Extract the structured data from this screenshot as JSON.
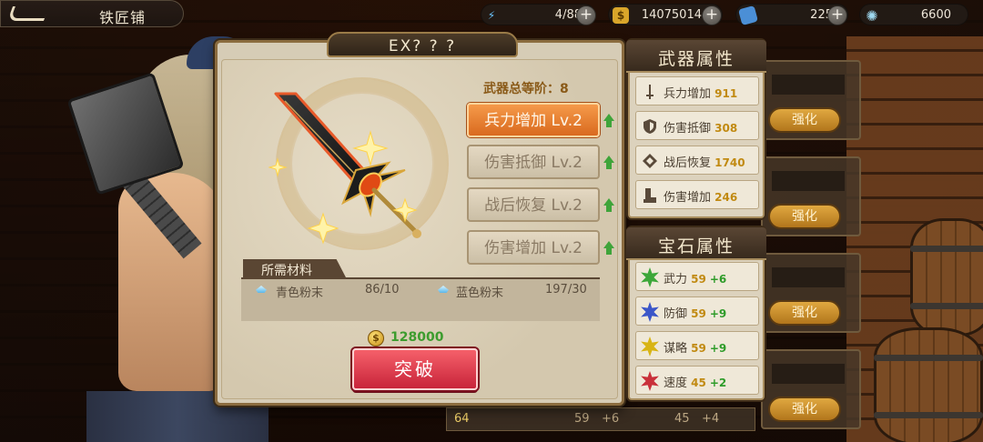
{
  "topbar": {
    "back_title": "铁匠铺",
    "stamina": "4/88",
    "gold": "14075014",
    "items": "225",
    "crystals": "6600",
    "plus": "+"
  },
  "dialog": {
    "title": "EX? ? ?",
    "rank_label": "武器总等阶：8",
    "stats": [
      {
        "label": "兵力增加 Lv.2",
        "state": "active"
      },
      {
        "label": "伤害抵御 Lv.2",
        "state": "inactive"
      },
      {
        "label": "战后恢复 Lv.2",
        "state": "inactive"
      },
      {
        "label": "伤害增加 Lv.2",
        "state": "inactive"
      }
    ],
    "materials_header": "所需材料",
    "materials": [
      {
        "name": "青色粉末",
        "count": "86/10"
      },
      {
        "name": "蓝色粉末",
        "count": "197/30"
      }
    ],
    "gold_cost": "128000",
    "gold_symbol": "$",
    "break_button": "突破"
  },
  "weapon_panel": {
    "title": "武器属性",
    "rows": [
      {
        "label": "兵力增加",
        "value": "911",
        "icon": "sword-icon"
      },
      {
        "label": "伤害抵御",
        "value": "308",
        "icon": "shield-icon"
      },
      {
        "label": "战后恢复",
        "value": "1740",
        "icon": "heal-icon"
      },
      {
        "label": "伤害增加",
        "value": "246",
        "icon": "boot-icon"
      }
    ]
  },
  "gem_panel": {
    "title": "宝石属性",
    "rows": [
      {
        "label": "武力",
        "value": "59",
        "bonus": "+6",
        "color": "#3da73a"
      },
      {
        "label": "防御",
        "value": "59",
        "bonus": "+9",
        "color": "#3b56c8"
      },
      {
        "label": "谋略",
        "value": "59",
        "bonus": "+9",
        "color": "#d8b414"
      },
      {
        "label": "速度",
        "value": "45",
        "bonus": "+2",
        "color": "#c9303a"
      }
    ]
  },
  "background_list": {
    "enhance_label": "强化",
    "bottom_left_value": "59",
    "bottom_left_bonus": "+6",
    "bottom_right_value": "45",
    "bottom_right_bonus": "+4",
    "level_badge": "64"
  },
  "colors": {
    "accent_orange": "#e07a2a",
    "break_red": "#d8303f",
    "bonus_green": "#2f9c2a",
    "value_gold": "#c18a12"
  }
}
